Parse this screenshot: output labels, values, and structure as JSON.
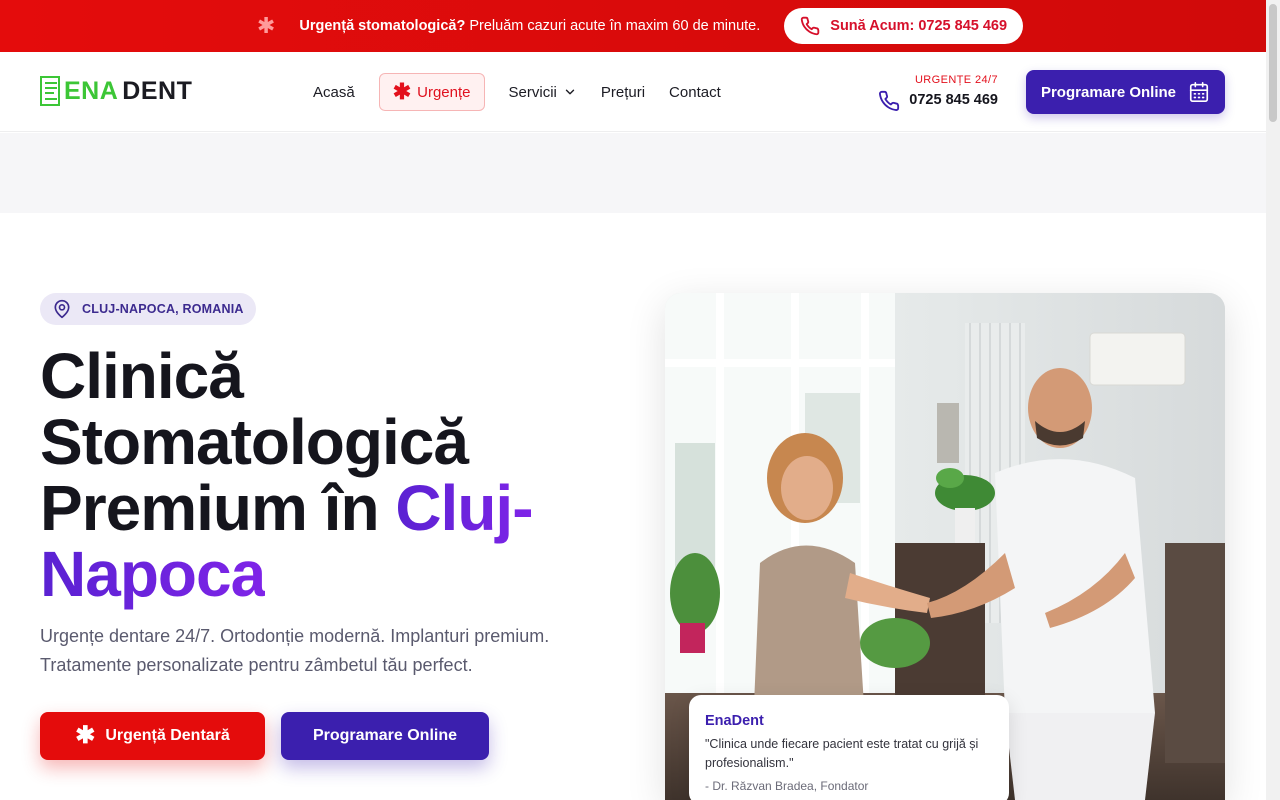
{
  "topbar": {
    "urgent_bold": "Urgență stomatologică?",
    "urgent_text": " Preluăm cazuri acute în maxim 60 de minute.",
    "call_label": "Sună Acum: 0725 845 469"
  },
  "header": {
    "logo_ena": "ENA",
    "logo_dent": "DENT",
    "nav": {
      "home": "Acasă",
      "urgent": "Urgențe",
      "services": "Servicii",
      "prices": "Prețuri",
      "contact": "Contact"
    },
    "phone_label": "URGENȚE 24/7",
    "phone_number": "0725 845 469",
    "cta": "Programare Online"
  },
  "hero": {
    "location": "CLUJ-NAPOCA, ROMANIA",
    "title_line1": "Clinică",
    "title_line2": "Stomatologică",
    "title_line3": "Premium în ",
    "title_accent1": "Cluj-",
    "title_accent2": "Napoca",
    "subtitle": "Urgențe dentare 24/7. Ortodonție modernă. Implanturi premium. Tratamente personalizate pentru zâmbetul tău perfect.",
    "btn_urgent": "Urgență Dentară",
    "btn_booking": "Programare Online"
  },
  "quote": {
    "name": "EnaDent",
    "text": "\"Clinica unde fiecare pacient este tratat cu grijă și profesionalism.\"",
    "author": "- Dr. Răzvan Bradea, Fondator"
  },
  "colors": {
    "brand_red": "#e40c0c",
    "brand_violet": "#3b1fae",
    "logo_green": "#3cc636"
  },
  "icons": [
    "asterisk-icon",
    "phone-icon",
    "chevron-down-icon",
    "calendar-icon",
    "location-pin-icon"
  ]
}
